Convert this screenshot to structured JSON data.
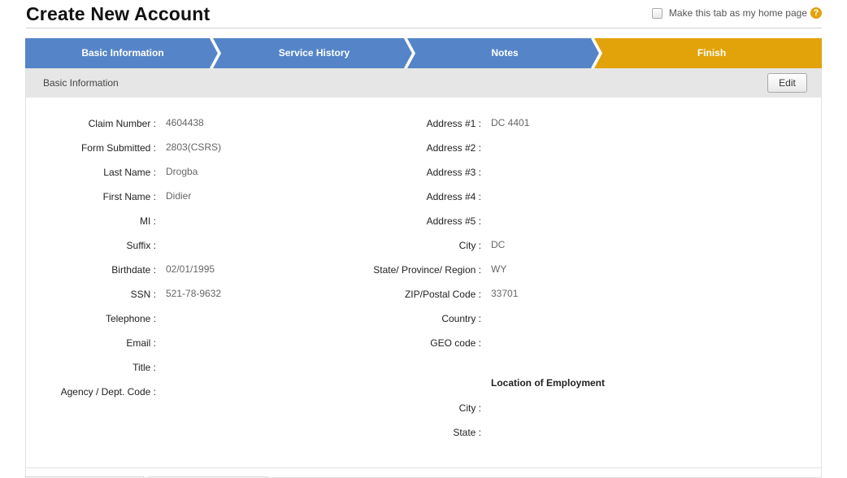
{
  "page": {
    "title": "Create New Account",
    "home_toggle_label": "Make this tab as my home page",
    "help_icon_glyph": "?"
  },
  "wizard": {
    "steps": [
      {
        "label": "Basic Information",
        "state": "complete"
      },
      {
        "label": "Service History",
        "state": "complete"
      },
      {
        "label": "Notes",
        "state": "complete"
      },
      {
        "label": "Finish",
        "state": "active"
      }
    ],
    "colors": {
      "step": "#5585c8",
      "active": "#e2a20a"
    }
  },
  "panel": {
    "title": "Basic Information",
    "edit_label": "Edit"
  },
  "left_fields": [
    {
      "label": "Claim Number :",
      "value": "4604438"
    },
    {
      "label": "Form Submitted :",
      "value": "2803(CSRS)"
    },
    {
      "label": "Last Name :",
      "value": "Drogba"
    },
    {
      "label": "First Name :",
      "value": "Didier"
    },
    {
      "label": "MI :",
      "value": ""
    },
    {
      "label": "Suffix :",
      "value": ""
    },
    {
      "label": "Birthdate :",
      "value": "02/01/1995"
    },
    {
      "label": "SSN :",
      "value": "521-78-9632"
    },
    {
      "label": "Telephone :",
      "value": ""
    },
    {
      "label": "Email :",
      "value": ""
    },
    {
      "label": "Title :",
      "value": ""
    },
    {
      "label": "Agency / Dept. Code :",
      "value": ""
    }
  ],
  "right_fields": [
    {
      "label": "Address #1 :",
      "value": "DC 4401"
    },
    {
      "label": "Address #2 :",
      "value": ""
    },
    {
      "label": "Address #3 :",
      "value": ""
    },
    {
      "label": "Address #4 :",
      "value": ""
    },
    {
      "label": "Address #5 :",
      "value": ""
    },
    {
      "label": "City :",
      "value": "DC"
    },
    {
      "label": "State/ Province/ Region :",
      "value": "WY"
    },
    {
      "label": "ZIP/Postal Code :",
      "value": "33701"
    },
    {
      "label": "Country :",
      "value": ""
    },
    {
      "label": "GEO code :",
      "value": ""
    }
  ],
  "employment": {
    "heading": "Location of Employment",
    "fields": [
      {
        "label": "City :",
        "value": ""
      },
      {
        "label": "State :",
        "value": ""
      }
    ]
  }
}
